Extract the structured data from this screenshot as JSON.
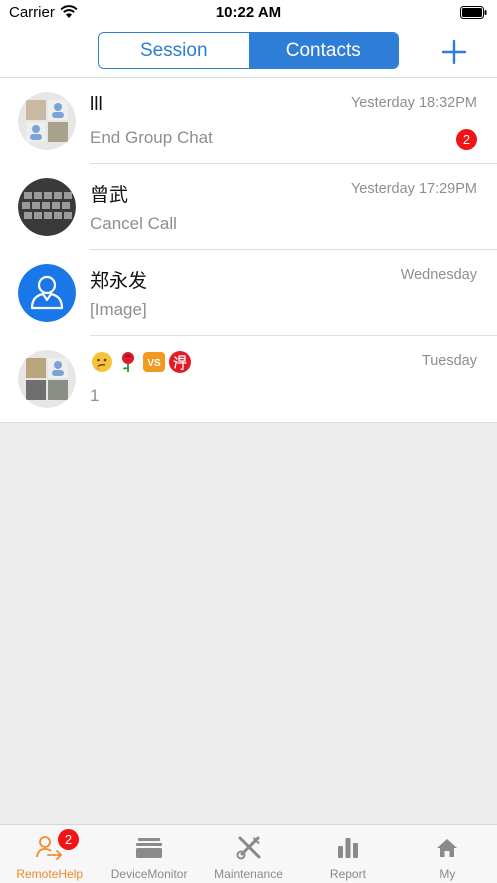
{
  "status_bar": {
    "carrier": "Carrier",
    "time": "10:22 AM"
  },
  "nav": {
    "segments": [
      {
        "label": "Session",
        "selected": false
      },
      {
        "label": "Contacts",
        "selected": true
      }
    ],
    "add_icon": "plus-icon"
  },
  "conversations": [
    {
      "name": "lll",
      "time": "Yesterday 18:32PM",
      "message": "End Group Chat",
      "unread": "2",
      "avatar": "group-collage"
    },
    {
      "name": "曾武",
      "time": "Yesterday 17:29PM",
      "message": "Cancel Call",
      "avatar": "keyboard-photo"
    },
    {
      "name": "郑永发",
      "time": "Wednesday",
      "message": "[Image]",
      "avatar": "default-person"
    },
    {
      "name_emojis": [
        "thinking-face-icon",
        "rose-icon",
        "vs-icon",
        "de-ideograph-icon"
      ],
      "time": "Tuesday",
      "message": "1",
      "avatar": "group-collage"
    }
  ],
  "tabs": [
    {
      "label": "RemoteHelp",
      "icon": "remote-help-icon",
      "badge": "2",
      "active": true
    },
    {
      "label": "DeviceMonitor",
      "icon": "device-monitor-icon",
      "active": false
    },
    {
      "label": "Maintenance",
      "icon": "tools-icon",
      "active": false
    },
    {
      "label": "Report",
      "icon": "bar-chart-icon",
      "active": false
    },
    {
      "label": "My",
      "icon": "home-icon",
      "active": false
    }
  ],
  "colors": {
    "accent": "#2e7dd7",
    "badge": "#f01414",
    "tab_active": "#f08a2a",
    "background": "#ececec"
  }
}
